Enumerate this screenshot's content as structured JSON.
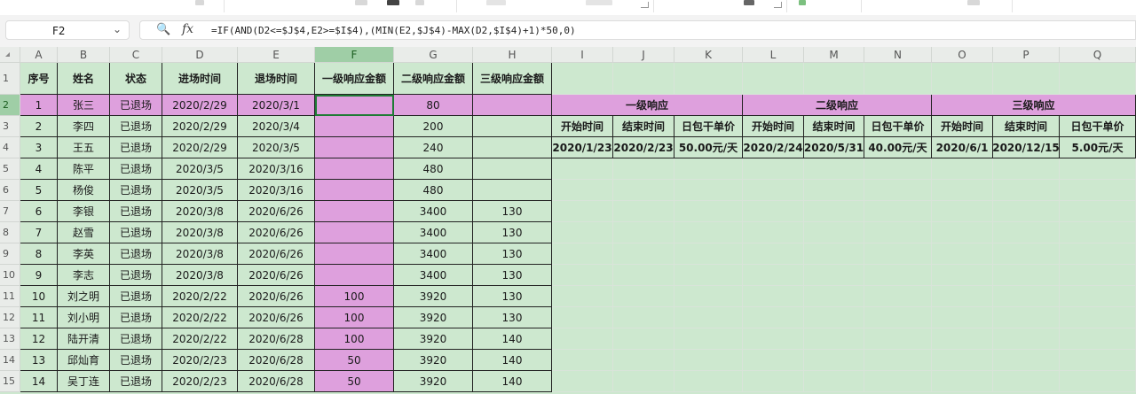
{
  "name_box": {
    "value": "F2",
    "dropdown": "⌄"
  },
  "formula_bar": {
    "zoom_icon": "🔍",
    "fx_label": "fx",
    "formula": "=IF(AND(D2<=$J$4,E2>=$I$4),(MIN(E2,$J$4)-MAX(D2,$I$4)+1)*50,0)"
  },
  "active_cell": "F2",
  "colors": {
    "highlight": "#dea0dd",
    "sheet_bg": "#cde8cf",
    "selected_header": "#9fcea6",
    "active_border": "#1e7b34"
  },
  "columns": [
    "A",
    "B",
    "C",
    "D",
    "E",
    "F",
    "G",
    "H",
    "I",
    "J",
    "K",
    "L",
    "M",
    "N",
    "O",
    "P",
    "Q"
  ],
  "row_numbers": [
    "1",
    "2",
    "3",
    "4",
    "5",
    "6",
    "7",
    "8",
    "9",
    "10",
    "11",
    "12",
    "13",
    "14",
    "15"
  ],
  "headers": [
    "序号",
    "姓名",
    "状态",
    "进场时间",
    "退场时间",
    "一级响应金额",
    "二级响应金额",
    "三级响应金额"
  ],
  "rows": [
    [
      "1",
      "张三",
      "已退场",
      "2020/2/29",
      "2020/3/1",
      "",
      "80",
      ""
    ],
    [
      "2",
      "李四",
      "已退场",
      "2020/2/29",
      "2020/3/4",
      "",
      "200",
      ""
    ],
    [
      "3",
      "王五",
      "已退场",
      "2020/2/29",
      "2020/3/5",
      "",
      "240",
      ""
    ],
    [
      "4",
      "陈平",
      "已退场",
      "2020/3/5",
      "2020/3/16",
      "",
      "480",
      ""
    ],
    [
      "5",
      "杨俊",
      "已退场",
      "2020/3/5",
      "2020/3/16",
      "",
      "480",
      ""
    ],
    [
      "6",
      "李银",
      "已退场",
      "2020/3/8",
      "2020/6/26",
      "",
      "3400",
      "130"
    ],
    [
      "7",
      "赵雪",
      "已退场",
      "2020/3/8",
      "2020/6/26",
      "",
      "3400",
      "130"
    ],
    [
      "8",
      "李英",
      "已退场",
      "2020/3/8",
      "2020/6/26",
      "",
      "3400",
      "130"
    ],
    [
      "9",
      "李志",
      "已退场",
      "2020/3/8",
      "2020/6/26",
      "",
      "3400",
      "130"
    ],
    [
      "10",
      "刘之明",
      "已退场",
      "2020/2/22",
      "2020/6/26",
      "100",
      "3920",
      "130"
    ],
    [
      "11",
      "刘小明",
      "已退场",
      "2020/2/22",
      "2020/6/26",
      "100",
      "3920",
      "130"
    ],
    [
      "12",
      "陆开清",
      "已退场",
      "2020/2/22",
      "2020/6/28",
      "100",
      "3920",
      "140"
    ],
    [
      "13",
      "邱灿育",
      "已退场",
      "2020/2/23",
      "2020/6/28",
      "50",
      "3920",
      "140"
    ],
    [
      "14",
      "吴丁连",
      "已退场",
      "2020/2/23",
      "2020/6/28",
      "50",
      "3920",
      "140"
    ]
  ],
  "response_table": {
    "groups": [
      "一级响应",
      "二级响应",
      "三级响应"
    ],
    "subheaders": [
      "开始时间",
      "结束时间",
      "日包干单价",
      "开始时间",
      "结束时间",
      "日包干单价",
      "开始时间",
      "结束时间",
      "日包干单价"
    ],
    "values": [
      "2020/1/23",
      "2020/2/23",
      "50.00元/天",
      "2020/2/24",
      "2020/5/31",
      "40.00元/天",
      "2020/6/1",
      "2020/12/15",
      "5.00元/天"
    ]
  }
}
